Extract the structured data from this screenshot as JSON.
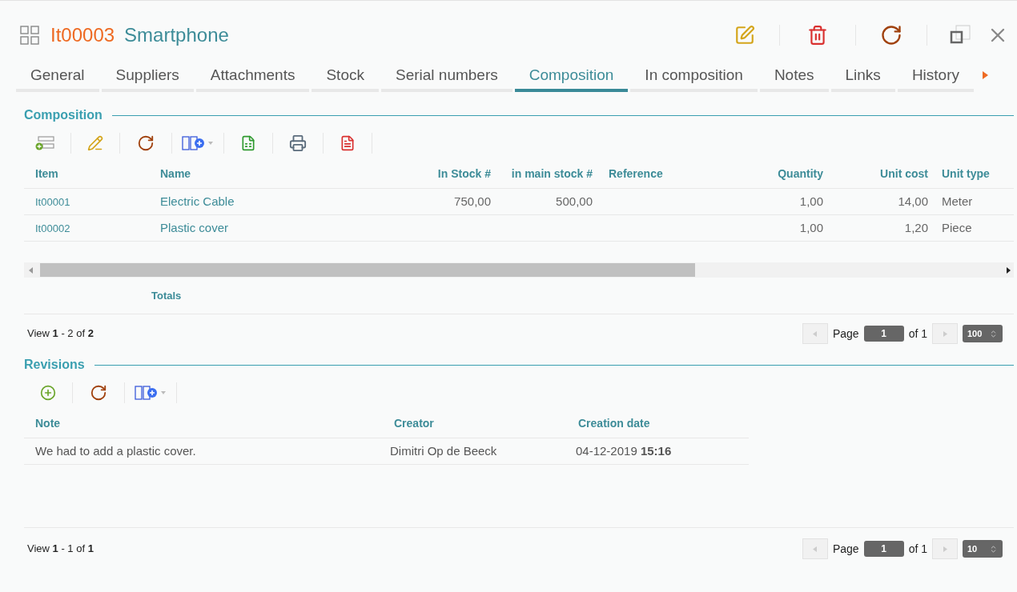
{
  "header": {
    "code": "It00003",
    "title": "Smartphone"
  },
  "tabs": [
    {
      "label": "General",
      "selected": false
    },
    {
      "label": "Suppliers",
      "selected": false
    },
    {
      "label": "Attachments",
      "selected": false
    },
    {
      "label": "Stock",
      "selected": false
    },
    {
      "label": "Serial numbers",
      "selected": false
    },
    {
      "label": "Composition",
      "selected": true
    },
    {
      "label": "In composition",
      "selected": false
    },
    {
      "label": "Notes",
      "selected": false
    },
    {
      "label": "Links",
      "selected": false
    },
    {
      "label": "History",
      "selected": false
    }
  ],
  "composition": {
    "heading": "Composition",
    "columns": [
      {
        "label": "Item"
      },
      {
        "label": "Name"
      },
      {
        "label": "In Stock #"
      },
      {
        "label": "in main stock #"
      },
      {
        "label": "Reference"
      },
      {
        "label": "Quantity"
      },
      {
        "label": "Unit cost"
      },
      {
        "label": "Unit type"
      }
    ],
    "rows": [
      [
        "It00001",
        "Electric Cable",
        "750,00",
        "500,00",
        "",
        "1,00",
        "14,00",
        "Meter"
      ],
      [
        "It00002",
        "Plastic cover",
        "",
        "",
        "",
        "1,00",
        "1,20",
        "Piece"
      ]
    ],
    "totals_label": "Totals",
    "pager": {
      "summary": "View **1** - 2 of **2**",
      "page_label": "Page",
      "page": "1",
      "of_label": "of 1",
      "page_size": "100"
    }
  },
  "revisions": {
    "heading": "Revisions",
    "columns": [
      {
        "label": "Note"
      },
      {
        "label": "Creator"
      },
      {
        "label": "Creation date"
      }
    ],
    "rows": [
      [
        "We had to add a plastic cover.",
        "Dimitri Op de Beeck",
        "04-12-2019 **15:16**"
      ]
    ],
    "pager": {
      "summary": "View **1** - 1 of **1**",
      "page_label": "Page",
      "page": "1",
      "of_label": "of 1",
      "page_size": "10"
    }
  }
}
